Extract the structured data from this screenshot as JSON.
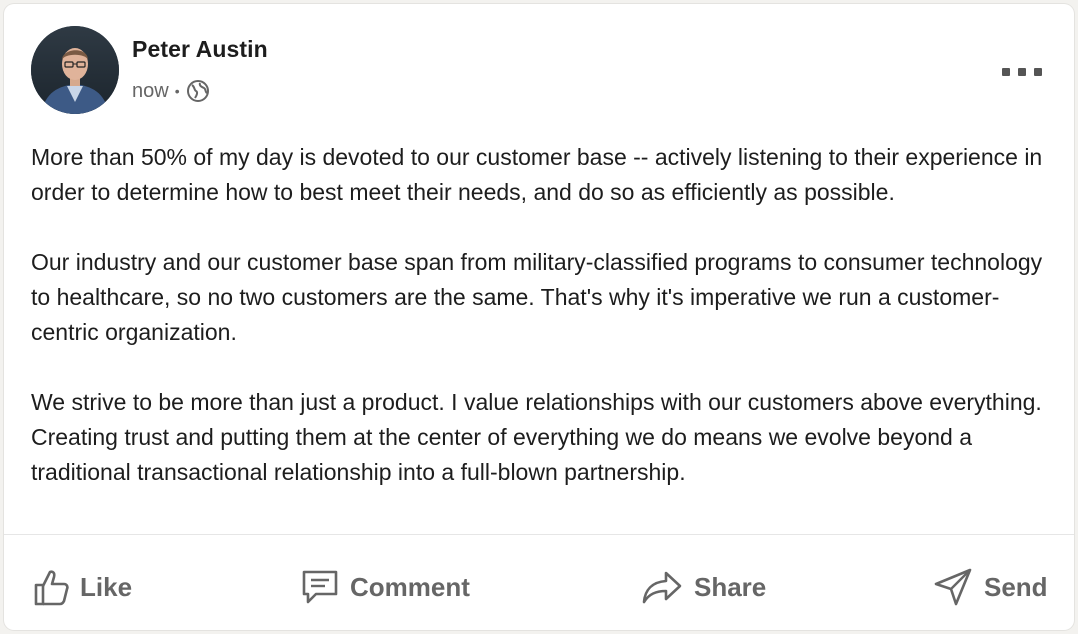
{
  "post": {
    "author_name": "Peter Austin",
    "timestamp": "now",
    "separator": "•",
    "visibility_icon": "globe-icon",
    "more_icon": "ellipsis-icon",
    "paragraphs": [
      "More than 50% of my day is devoted to our customer base -- actively listening to their experience in order to determine how to best meet their needs, and do so as efficiently as possible.",
      "Our industry and our customer base span from military-classified programs to consumer technology to healthcare, so no two customers are the same. That's why it's imperative we run a customer-centric organization.",
      "We strive to be more than just a product. I value relationships with our customers above everything. Creating trust and putting them at the center of everything we do means we evolve beyond a traditional transactional relationship into a full-blown partnership."
    ]
  },
  "actions": {
    "like_label": "Like",
    "comment_label": "Comment",
    "share_label": "Share",
    "send_label": "Send"
  },
  "colors": {
    "text_primary": "#1d1d1d",
    "text_secondary": "#666666",
    "background": "#ffffff"
  }
}
